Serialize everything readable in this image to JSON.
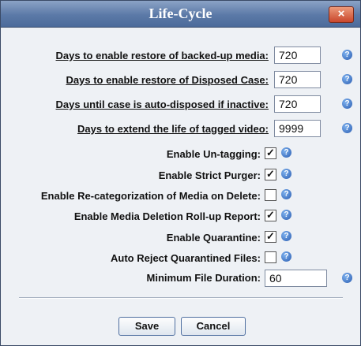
{
  "dialog": {
    "title": "Life-Cycle",
    "close_glyph": "×"
  },
  "fields": [
    {
      "label": "Days to enable restore of backed-up media:",
      "value": "720",
      "help_icon": "help-icon"
    },
    {
      "label": "Days to enable restore of Disposed Case:",
      "value": "720",
      "help_icon": "help-icon"
    },
    {
      "label": "Days until case is auto-disposed if inactive:",
      "value": "720",
      "help_icon": "help-icon"
    },
    {
      "label": "Days to extend the life of tagged video:",
      "value": "9999",
      "help_icon": "help-icon"
    }
  ],
  "checkboxes": [
    {
      "label": "Enable Un-tagging:",
      "checked": true
    },
    {
      "label": "Enable Strict Purger:",
      "checked": true
    },
    {
      "label": "Enable Re-categorization of Media on Delete:",
      "checked": false
    },
    {
      "label": "Enable Media Deletion Roll-up Report:",
      "checked": true
    },
    {
      "label": "Enable Quarantine:",
      "checked": true
    },
    {
      "label": "Auto Reject Quarantined Files:",
      "checked": false
    }
  ],
  "min_duration": {
    "label": "Minimum File Duration:",
    "value": "60"
  },
  "buttons": {
    "save": "Save",
    "cancel": "Cancel"
  },
  "colors": {
    "titlebar": "#5b79a7",
    "close": "#c9472c",
    "help": "#2a5cb0",
    "background": "#eef1f5"
  }
}
